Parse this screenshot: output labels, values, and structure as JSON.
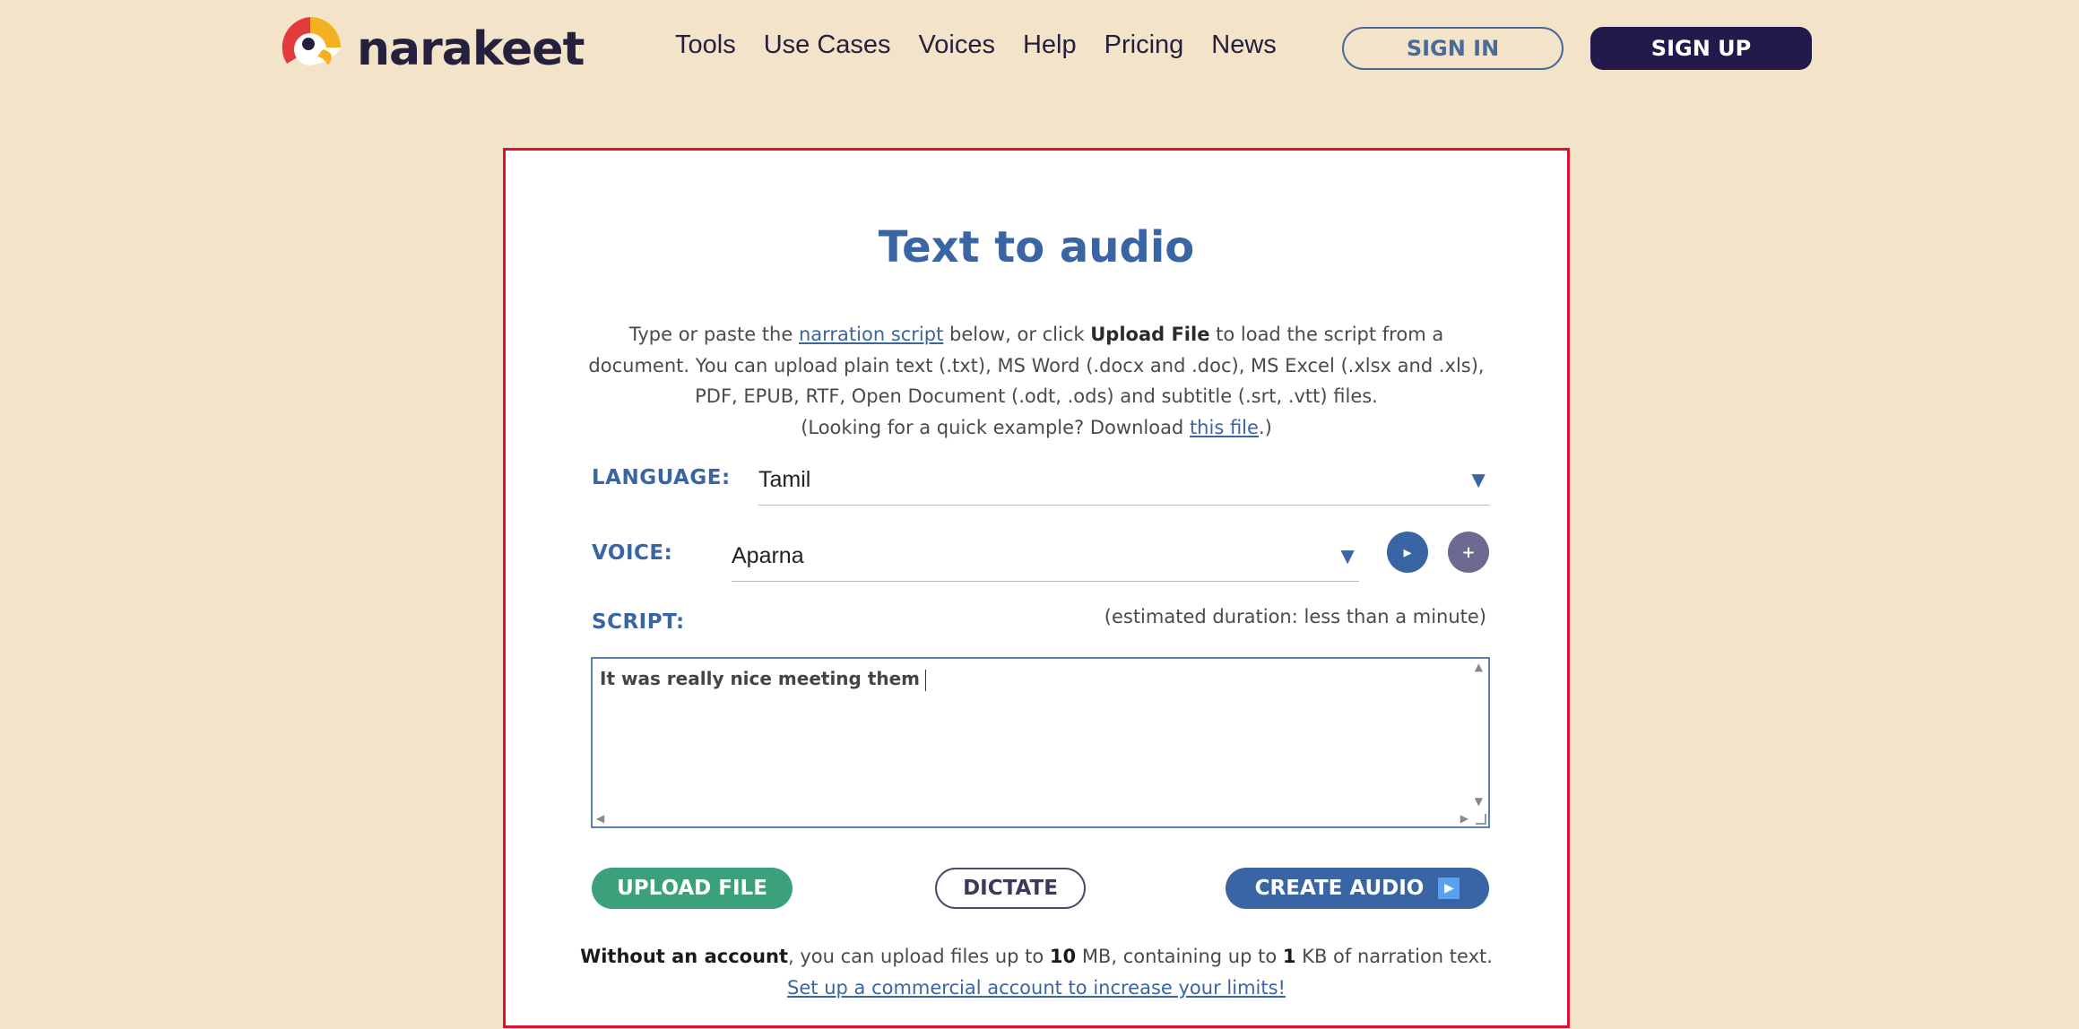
{
  "header": {
    "brand": "narakeet",
    "nav": [
      "Tools",
      "Use Cases",
      "Voices",
      "Help",
      "Pricing",
      "News"
    ],
    "signin_label": "SIGN IN",
    "signup_label": "SIGN UP"
  },
  "card": {
    "title": "Text to audio",
    "intro": {
      "part1": "Type or paste the ",
      "link1": "narration script",
      "part2": " below, or click ",
      "bold": "Upload File",
      "part3": " to load the script from a document. You can upload plain text (.txt), MS Word (.docx and .doc), MS Excel (.xlsx and .xls), PDF, EPUB, RTF, Open Document (.odt, .ods) and subtitle (.srt, .vtt) files.",
      "part4": "(Looking for a quick example? Download ",
      "link2": "this file",
      "part5": ".)"
    },
    "language": {
      "label": "LANGUAGE:",
      "value": "Tamil"
    },
    "voice": {
      "label": "VOICE:",
      "value": "Aparna"
    },
    "script": {
      "label": "SCRIPT:",
      "duration": "(estimated duration: less than a minute)",
      "text": "It was really nice meeting them"
    },
    "buttons": {
      "upload": "UPLOAD FILE",
      "dictate": "DICTATE",
      "create": "CREATE AUDIO"
    },
    "limits": {
      "bold1": "Without an account",
      "part1": ", you can upload files up to ",
      "bold2": "10",
      "part2": " MB, containing up to ",
      "bold3": "1",
      "part3": " KB of narration text.",
      "link": "Set up a commercial account to increase your limits!"
    }
  },
  "icons": {
    "logo": "parrot-logo-icon",
    "dropdown": "triangle-down-icon",
    "play": "play-icon",
    "add": "plus-icon"
  },
  "colors": {
    "background": "#f2e3c9",
    "brand_dark": "#211a4a",
    "accent_blue": "#3a65a4",
    "upload_green": "#3aa17a",
    "card_border": "#e3112c"
  }
}
